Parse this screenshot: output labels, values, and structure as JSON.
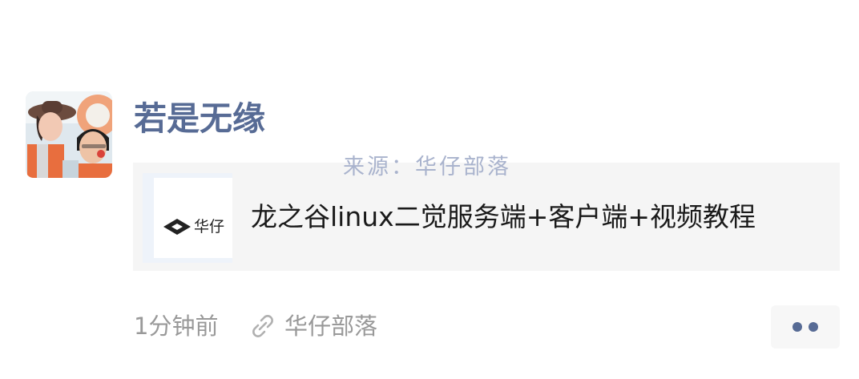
{
  "post": {
    "author": "若是无缘",
    "watermark": "来源：华仔部落",
    "link_card": {
      "thumbnail_text": "华仔",
      "title": "龙之谷linux二觉服务端+客户端+视频教程"
    },
    "time": "1分钟前",
    "source": "华仔部落",
    "icons": {
      "avatar": "avatar-photo",
      "thumbnail_logo": "diamond-logo-icon",
      "source": "link-icon",
      "more": "more-dots-icon"
    },
    "colors": {
      "name": "#576b95",
      "card_background": "#f5f5f5",
      "meta_text": "#999999",
      "watermark": "#a9b3cd"
    }
  }
}
